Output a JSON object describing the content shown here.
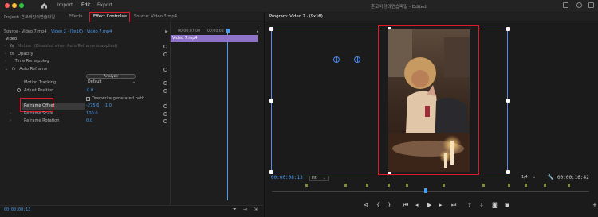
{
  "app": {
    "title": "혼코바강의연습파일 - Edited",
    "menu": [
      "Import",
      "Edit",
      "Export"
    ],
    "active_menu": "Edit"
  },
  "left_panel": {
    "tabs": {
      "project": "Project: 혼코바강의연습파일",
      "effects": "Effects",
      "effect_controls": "Effect Controls",
      "effect_controls_menu": "≡",
      "source": "Source: Video 3.mp4"
    },
    "source_line": {
      "source": "Source · Video 7.mp4",
      "sequence": "Video 2 · (9x16) · Video 7.mp4"
    },
    "section_label": "Video",
    "rows": {
      "motion": "Motion",
      "motion_note": "(Disabled when Auto Reframe is applied)",
      "opacity": "Opacity",
      "time_remapping": "Time Remapping",
      "auto_reframe": "Auto Reframe",
      "analyze": "Analyze",
      "motion_tracking": "Motion Tracking",
      "motion_tracking_value": "Default",
      "adjust_position": "Adjust Position",
      "adjust_position_value": "0.0",
      "overwrite": "Overwrite generated path",
      "reframe_offset": "Reframe Offset",
      "reframe_offset_x": "-275.6",
      "reframe_offset_y": "-1.0",
      "reframe_scale": "Reframe Scale",
      "reframe_scale_value": "100.0",
      "reframe_rotation": "Reframe Rotation",
      "reframe_rotation_value": "0.0"
    },
    "timeline": {
      "t0": "00;00;07;00",
      "t1": "00;00;08",
      "clip": "Video 7.mp4"
    },
    "current_time": "00:00:08:13"
  },
  "program": {
    "title": "Program: Video 2 · (9x16)",
    "menu_icon": "≡",
    "timecode": "00:00:08:13",
    "fit": "Fit",
    "quality": "1/4",
    "duration": "00:00:16:42"
  },
  "colors": {
    "accent": "#4a9cf2",
    "highlight": "#e0192a",
    "clip": "#8f73c8"
  }
}
